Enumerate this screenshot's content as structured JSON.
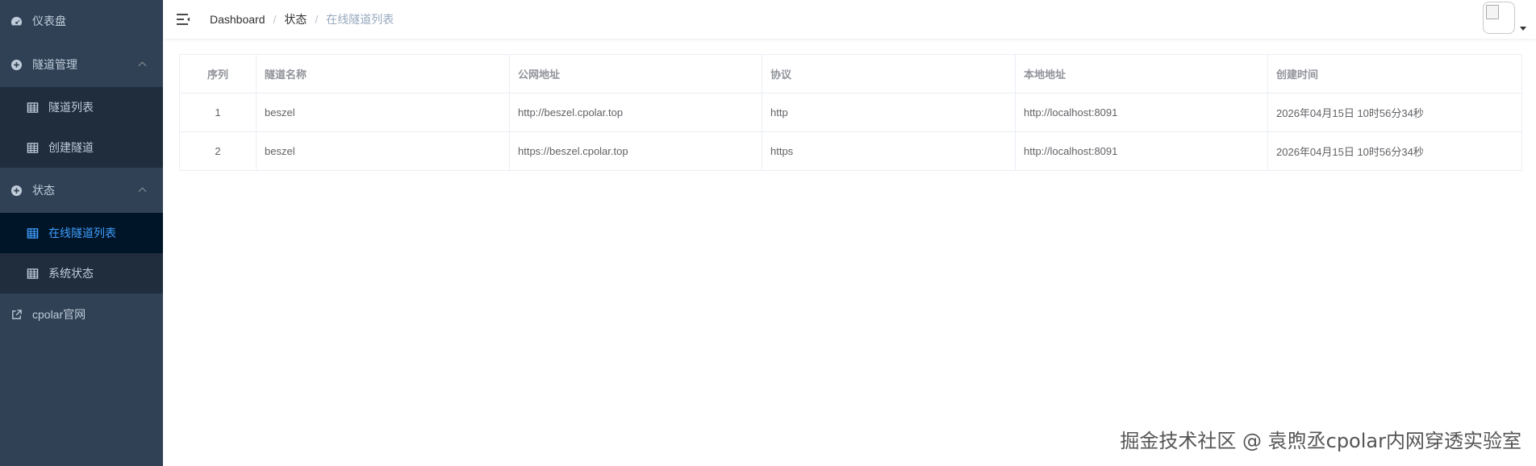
{
  "sidebar": {
    "dashboard": {
      "label": "仪表盘",
      "icon": "dashboard-icon"
    },
    "tunnel_group": {
      "label": "隧道管理",
      "icon": "plus-circle-icon",
      "items": [
        {
          "label": "隧道列表",
          "icon": "table-icon"
        },
        {
          "label": "创建隧道",
          "icon": "table-icon"
        }
      ]
    },
    "status_group": {
      "label": "状态",
      "icon": "plus-circle-icon",
      "items": [
        {
          "label": "在线隧道列表",
          "icon": "table-icon",
          "active": true
        },
        {
          "label": "系统状态",
          "icon": "table-icon"
        }
      ]
    },
    "external": {
      "label": "cpolar官网",
      "icon": "external-link-icon"
    }
  },
  "header": {
    "breadcrumb": [
      "Dashboard",
      "状态",
      "在线隧道列表"
    ],
    "separator": "/"
  },
  "table": {
    "columns": [
      "序列",
      "隧道名称",
      "公网地址",
      "协议",
      "本地地址",
      "创建时间"
    ],
    "rows": [
      [
        "1",
        "beszel",
        "http://beszel.cpolar.top",
        "http",
        "http://localhost:8091",
        "2026年04月15日 10时56分34秒"
      ],
      [
        "2",
        "beszel",
        "https://beszel.cpolar.top",
        "https",
        "http://localhost:8091",
        "2026年04月15日 10时56分34秒"
      ]
    ]
  },
  "watermark": "掘金技术社区 @ 袁煦丞cpolar内网穿透实验室",
  "colors": {
    "sidebar_bg": "#304156",
    "submenu_bg": "#1f2d3d",
    "active_bg": "#001528",
    "active_text": "#409eff",
    "menu_text": "#bfcbd9"
  }
}
